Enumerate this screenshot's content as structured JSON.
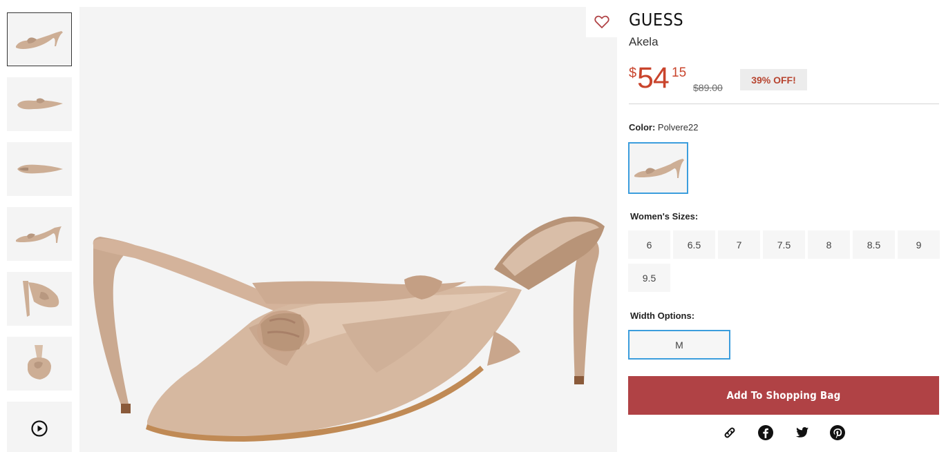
{
  "product": {
    "brand": "GUESS",
    "name": "Akela",
    "price": {
      "currency_symbol": "$",
      "dollars": "54",
      "cents": "15",
      "original": "$89.00",
      "discount": "39% OFF!"
    },
    "color": {
      "label": "Color:",
      "value": "Polvere22"
    },
    "sizes": {
      "label": "Women's Sizes:",
      "options": [
        "6",
        "6.5",
        "7",
        "7.5",
        "8",
        "8.5",
        "9",
        "9.5"
      ]
    },
    "width": {
      "label": "Width Options:",
      "options": [
        "M"
      ],
      "selected": "M"
    },
    "add_to_bag_label": "Add To Shopping Bag"
  },
  "gallery": {
    "thumbnails": [
      "side-view",
      "top-view",
      "sole-view",
      "side-view-2",
      "back-view",
      "front-view",
      "video"
    ],
    "selected_index": 0
  },
  "share": [
    "link-icon",
    "facebook-icon",
    "twitter-icon",
    "pinterest-icon"
  ],
  "colors": {
    "price": "#c9442c",
    "accent_border": "#3b9ddd",
    "add_button": "#b04245",
    "discount_text": "#b7442f"
  }
}
